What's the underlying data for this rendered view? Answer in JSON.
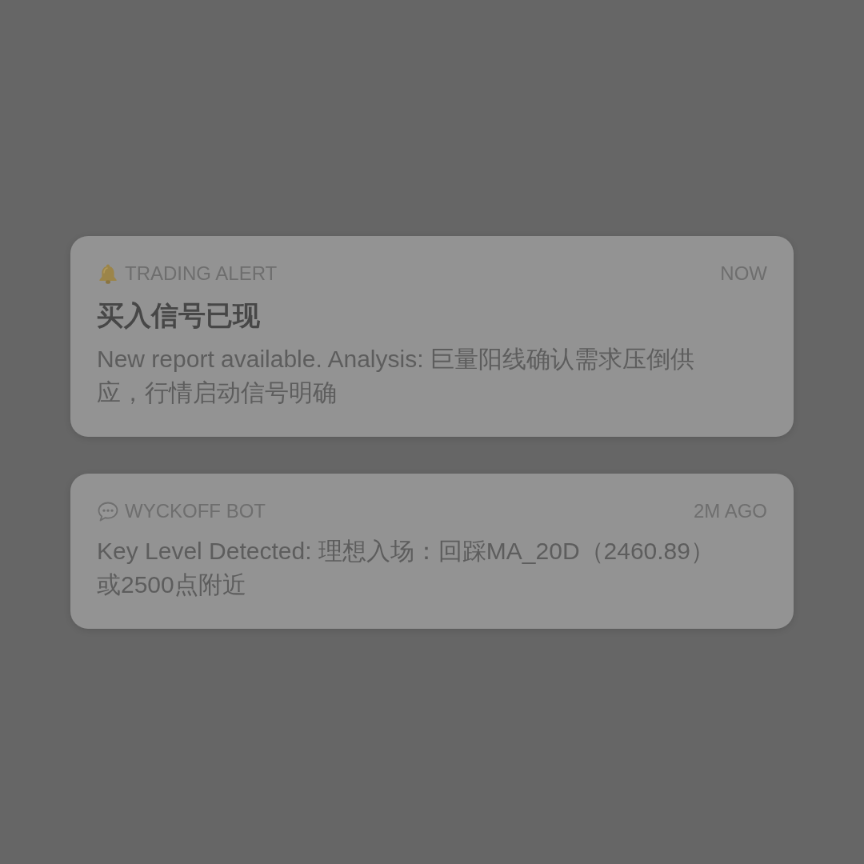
{
  "notifications": [
    {
      "kind": "alert",
      "app": "TRADING ALERT",
      "time": "NOW",
      "title": "买入信号已现",
      "body": "New report available. Analysis: 巨量阳线确认需求压倒供应，行情启动信号明确"
    },
    {
      "kind": "message",
      "app": "WYCKOFF BOT",
      "time": "2M AGO",
      "body": "Key Level Detected: 理想入场：回踩MA_20D（2460.89）或2500点附近"
    }
  ]
}
